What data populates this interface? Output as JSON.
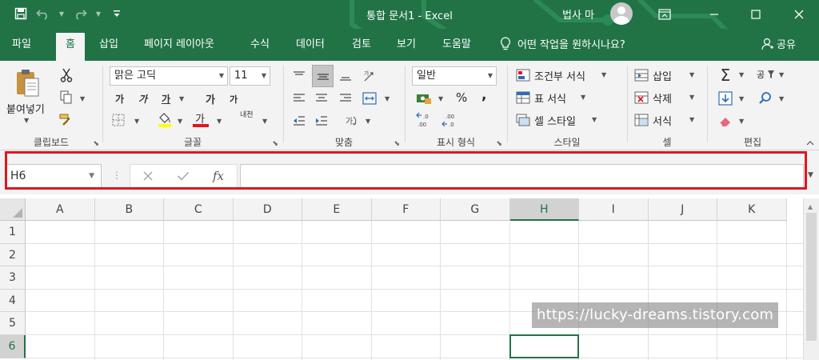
{
  "titlebar": {
    "doc_title": "통합 문서1  -  Excel",
    "user_name": "법사 마"
  },
  "tabs": [
    {
      "label": "파일"
    },
    {
      "label": "홈"
    },
    {
      "label": "삽입"
    },
    {
      "label": "페이지 레이아웃"
    },
    {
      "label": "수식"
    },
    {
      "label": "데이터"
    },
    {
      "label": "검토"
    },
    {
      "label": "보기"
    },
    {
      "label": "도움말"
    }
  ],
  "tellme": {
    "label": "어떤 작업을 원하시나요?"
  },
  "share": {
    "label": "공유"
  },
  "ribbon": {
    "clipboard": {
      "label": "클립보드",
      "paste_label": "붙여넣기"
    },
    "font": {
      "label": "글꼴",
      "font_name": "맑은 고딕",
      "font_size": "11",
      "bold": "가",
      "italic": "가",
      "underline": "가",
      "grow": "가",
      "shrink": "가",
      "font_color_glyph": "가",
      "phonetic": "내천"
    },
    "alignment": {
      "label": "맞춤"
    },
    "number": {
      "label": "표시 형식",
      "format": "일반",
      "percent": "%",
      "comma": ","
    },
    "styles": {
      "label": "스타일",
      "conditional": "조건부 서식",
      "table": "표 서식",
      "cell_styles": "셀 스타일"
    },
    "cells": {
      "label": "셀",
      "insert": "삽입",
      "delete": "삭제",
      "format": "서식"
    },
    "editing": {
      "label": "편집",
      "sort_glyph": "공"
    }
  },
  "formula_bar": {
    "name_box": "H6",
    "fx": "fx",
    "formula": ""
  },
  "grid": {
    "columns": [
      "A",
      "B",
      "C",
      "D",
      "E",
      "F",
      "G",
      "H",
      "I",
      "J",
      "K"
    ],
    "rows": [
      "1",
      "2",
      "3",
      "4",
      "5",
      "6"
    ],
    "selected_column": "H",
    "selected_row": "6"
  },
  "watermark": "https://lucky-dreams.tistory.com",
  "colors": {
    "brand": "#217346",
    "ribbon_bg": "#f3f3f3",
    "highlight": "#e0161f"
  }
}
